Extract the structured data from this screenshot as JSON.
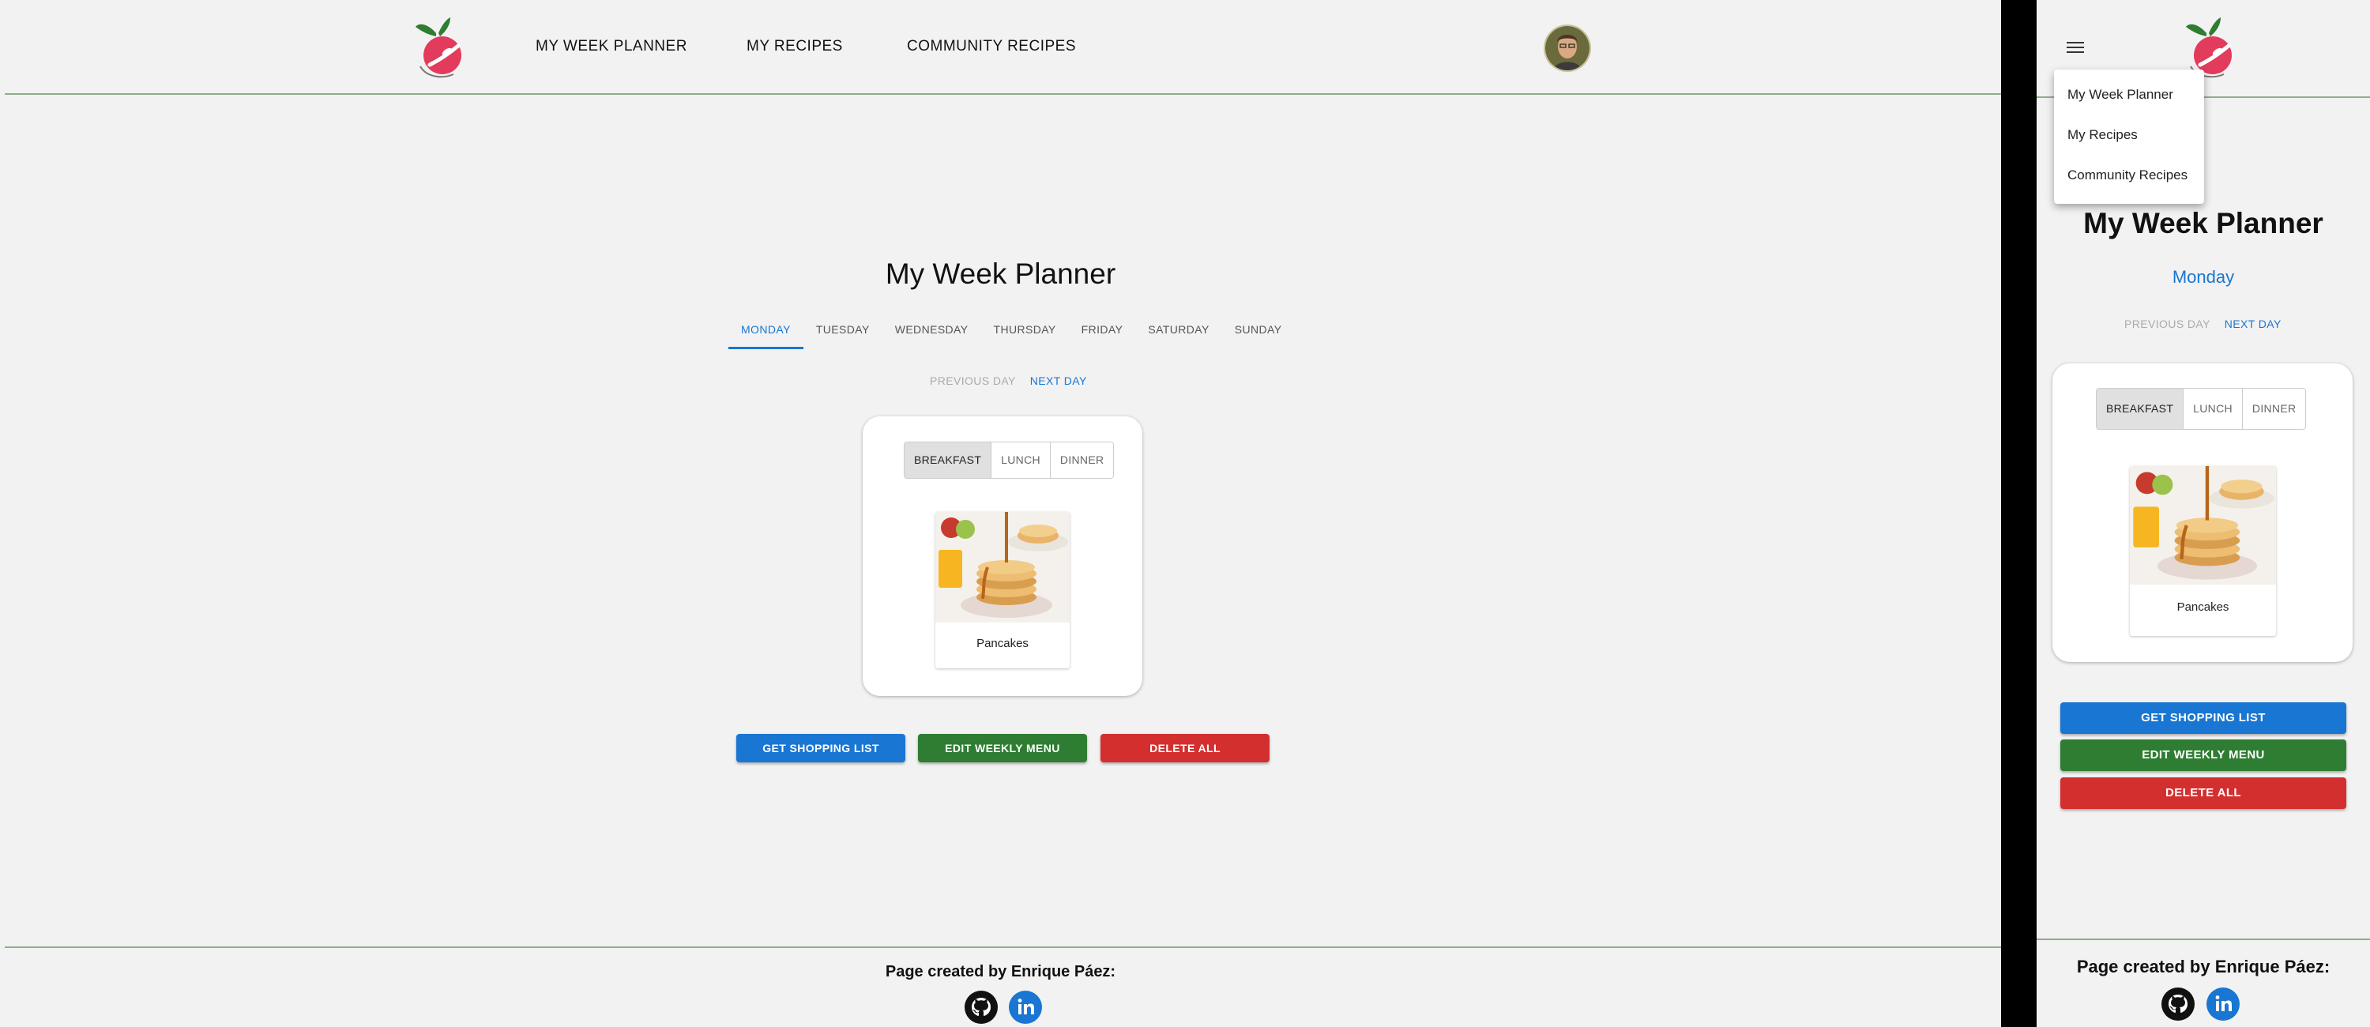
{
  "desktop": {
    "nav": {
      "items": [
        "MY WEEK PLANNER",
        "MY RECIPES",
        "COMMUNITY RECIPES"
      ]
    },
    "title": "My Week Planner",
    "days": [
      "MONDAY",
      "TUESDAY",
      "WEDNESDAY",
      "THURSDAY",
      "FRIDAY",
      "SATURDAY",
      "SUNDAY"
    ],
    "active_day_index": 0,
    "day_nav": {
      "prev": "PREVIOUS DAY",
      "next": "NEXT DAY"
    },
    "meals": [
      "BREAKFAST",
      "LUNCH",
      "DINNER"
    ],
    "active_meal_index": 0,
    "recipe": {
      "name": "Pancakes"
    },
    "buttons": {
      "shopping": "GET SHOPPING LIST",
      "edit": "EDIT WEEKLY MENU",
      "delete": "DELETE ALL"
    },
    "footer": {
      "text": "Page created by Enrique Páez:"
    }
  },
  "mobile": {
    "menu": [
      "My Week Planner",
      "My Recipes",
      "Community Recipes"
    ],
    "title": "My Week Planner",
    "day": "Monday",
    "day_nav": {
      "prev": "PREVIOUS DAY",
      "next": "NEXT DAY"
    },
    "meals": [
      "BREAKFAST",
      "LUNCH",
      "DINNER"
    ],
    "active_meal_index": 0,
    "recipe": {
      "name": "Pancakes"
    },
    "buttons": {
      "shopping": "GET SHOPPING LIST",
      "edit": "EDIT WEEKLY MENU",
      "delete": "DELETE ALL"
    },
    "footer": {
      "text": "Page created by Enrique Páez:"
    }
  },
  "colors": {
    "accent": "#1976d2",
    "green": "#2e7d32",
    "red": "#d32f2f",
    "divider_line": "#8fae8c",
    "background": "#f2f2f2"
  },
  "icons": [
    "app-logo-icon",
    "avatar",
    "hamburger-menu-icon",
    "github-icon",
    "linkedin-icon"
  ]
}
